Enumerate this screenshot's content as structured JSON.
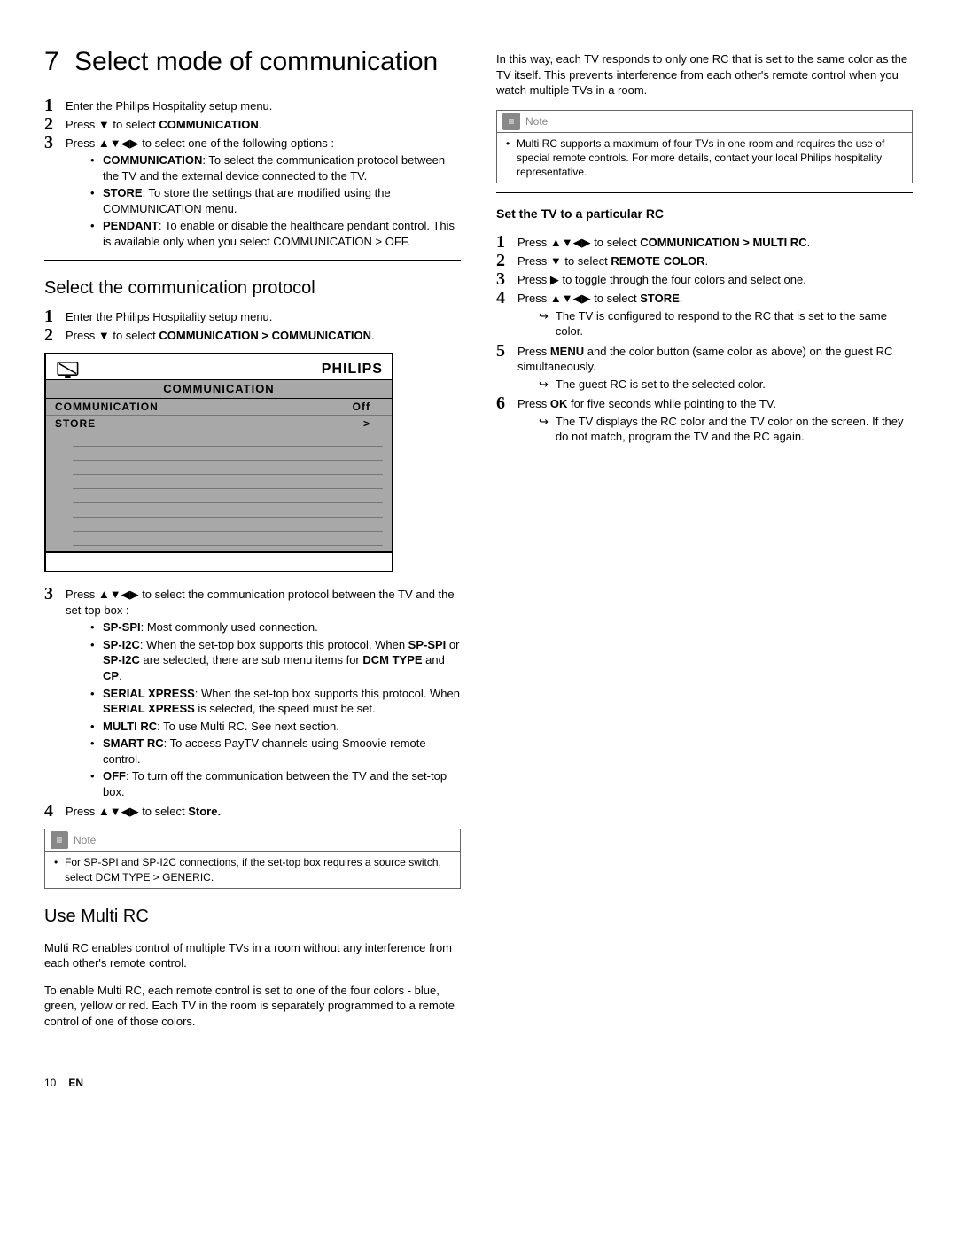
{
  "chapter": {
    "num": "7",
    "title": "Select mode of communication"
  },
  "introSteps": [
    {
      "n": "1",
      "t": "Enter the Philips Hospitality setup menu."
    },
    {
      "n": "2",
      "pre": "Press ",
      "arrows": "▼",
      "post": " to select ",
      "strong": "COMMUNICATION",
      "tail": "."
    },
    {
      "n": "3",
      "pre": "Press ",
      "arrows": "▲▼◀▶",
      "post": " to select one of the following options :",
      "bullets": [
        {
          "strong": "COMMUNICATION",
          "rest": ": To select the communication protocol between the TV and the external device connected to the TV."
        },
        {
          "strong": "STORE",
          "rest": ": To store the settings that are modified using the COMMUNICATION menu."
        },
        {
          "strong": "PENDANT",
          "rest": ": To enable or disable the healthcare pendant control. This is available only when you select COMMUNICATION > OFF."
        }
      ]
    }
  ],
  "sec1": {
    "title": "Select the communication protocol",
    "steps12": [
      {
        "n": "1",
        "t": "Enter the Philips Hospitality setup menu."
      },
      {
        "n": "2",
        "pre": "Press ",
        "arrows": "▼",
        "post": " to select ",
        "strong": "COMMUNICATION > COMMUNICATION",
        "tail": "."
      }
    ],
    "menu": {
      "brand": "PHILIPS",
      "title": "COMMUNICATION",
      "rows": [
        {
          "l": "COMMUNICATION",
          "r": "Off"
        },
        {
          "l": "STORE",
          "r": ">"
        }
      ]
    },
    "step3": {
      "n": "3",
      "pre": "Press ",
      "arrows": "▲▼◀▶",
      "post": " to select the communication protocol between the TV and the set-top box :",
      "bullets": [
        {
          "strong": "SP-SPI",
          "rest": ": Most commonly used connection."
        },
        {
          "strong": "SP-I2C",
          "rest": ": When the set-top box supports this protocol. When ",
          "strong2": "SP-SPI",
          "mid": " or ",
          "strong3": "SP-I2C",
          "rest2": " are selected, there are sub menu items for ",
          "strong4": "DCM TYPE",
          "mid2": " and ",
          "strong5": "CP",
          "tail": "."
        },
        {
          "strong": "SERIAL XPRESS",
          "rest": ": When the set-top box supports this protocol. When ",
          "strong2": "SERIAL XPRESS",
          "rest2": " is selected, the speed must be set."
        },
        {
          "strong": "MULTI RC",
          "rest": ": To use Multi RC. See next section."
        },
        {
          "strong": "SMART RC",
          "rest": ": To access PayTV channels using Smoovie remote control."
        },
        {
          "strong": "OFF",
          "rest": ": To turn off the communication between the TV and the set-top box."
        }
      ]
    },
    "step4": {
      "n": "4",
      "pre": "Press ",
      "arrows": "▲▼◀▶",
      "post": " to select ",
      "strong": "Store.",
      "tail": ""
    },
    "note": {
      "label": "Note",
      "text": "For SP-SPI and SP-I2C connections, if the set-top box requires a source switch, select DCM TYPE > GENERIC."
    }
  },
  "sec2": {
    "title": "Use Multi RC",
    "paras": [
      "Multi RC enables control of multiple TVs in a room without any interference from each other's remote control.",
      "To enable Multi RC, each remote control is set to one of the four colors - blue, green, yellow or red. Each TV in the room is separately programmed to a remote control of one of those colors.",
      "In this way, each TV responds to only one RC that is set to the same color as the TV itself. This prevents interference from each other's remote control when you watch multiple TVs in a room."
    ],
    "note": {
      "label": "Note",
      "text": "Multi RC supports a maximum of four TVs in one room and requires the use of special remote controls. For more details, contact your local Philips hospitality representative."
    }
  },
  "sec3": {
    "title": "Set the TV to a particular RC",
    "steps": [
      {
        "n": "1",
        "pre": "Press ",
        "arrows": "▲▼◀▶",
        "post": " to select ",
        "strong": "COMMUNICATION > MULTI RC",
        "tail": "."
      },
      {
        "n": "2",
        "pre": "Press ",
        "arrows": "▼",
        "post": " to select ",
        "strong": "REMOTE COLOR",
        "tail": "."
      },
      {
        "n": "3",
        "pre": "Press ",
        "arrows": "▶",
        "post": " to toggle through the four colors and select one."
      },
      {
        "n": "4",
        "pre": "Press ",
        "arrows": "▲▼◀▶",
        "post": " to select ",
        "strong": "STORE",
        "tail": ".",
        "sub": "The TV is configured to respond to the RC that is set to the same color."
      },
      {
        "n": "5",
        "pre": "Press ",
        "strong0": "MENU",
        "mid0": " and the color button (same color as above) on the guest RC simultaneously.",
        "sub": "The guest RC is set to the selected color."
      },
      {
        "n": "6",
        "pre": "Press ",
        "strong0": "OK",
        "mid0": " for five seconds while pointing to the TV.",
        "sub": "The TV displays the RC color and the TV color on the screen. If they do not match, program the TV and the RC again."
      }
    ]
  },
  "footer": {
    "page": "10",
    "lang": "EN"
  }
}
